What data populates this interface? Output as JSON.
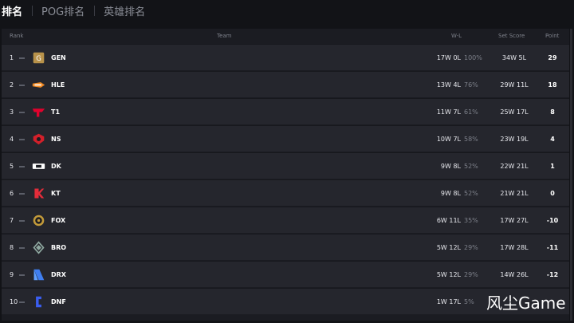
{
  "tabs": [
    {
      "label": "排名"
    },
    {
      "label": "POG排名"
    },
    {
      "label": "英雄排名"
    }
  ],
  "headers": {
    "rank": "Rank",
    "team": "Team",
    "wl": "W-L",
    "score": "Set Score",
    "point": "Point"
  },
  "rows": [
    {
      "rank": "1",
      "team": "GEN",
      "wl": "17W 0L",
      "pct": "100%",
      "score": "34W 5L",
      "point": "29",
      "logo": "gen-logo"
    },
    {
      "rank": "2",
      "team": "HLE",
      "wl": "13W 4L",
      "pct": "76%",
      "score": "29W 11L",
      "point": "18",
      "logo": "hle-logo"
    },
    {
      "rank": "3",
      "team": "T1",
      "wl": "11W 7L",
      "pct": "61%",
      "score": "25W 17L",
      "point": "8",
      "logo": "t1-logo"
    },
    {
      "rank": "4",
      "team": "NS",
      "wl": "10W 7L",
      "pct": "58%",
      "score": "23W 19L",
      "point": "4",
      "logo": "ns-logo"
    },
    {
      "rank": "5",
      "team": "DK",
      "wl": "9W 8L",
      "pct": "52%",
      "score": "22W 21L",
      "point": "1",
      "logo": "dk-logo"
    },
    {
      "rank": "6",
      "team": "KT",
      "wl": "9W 8L",
      "pct": "52%",
      "score": "21W 21L",
      "point": "0",
      "logo": "kt-logo"
    },
    {
      "rank": "7",
      "team": "FOX",
      "wl": "6W 11L",
      "pct": "35%",
      "score": "17W 27L",
      "point": "-10",
      "logo": "fox-logo"
    },
    {
      "rank": "8",
      "team": "BRO",
      "wl": "5W 12L",
      "pct": "29%",
      "score": "17W 28L",
      "point": "-11",
      "logo": "bro-logo"
    },
    {
      "rank": "9",
      "team": "DRX",
      "wl": "5W 12L",
      "pct": "29%",
      "score": "14W 26L",
      "point": "-12",
      "logo": "drx-logo"
    },
    {
      "rank": "10",
      "team": "DNF",
      "wl": "1W 17L",
      "pct": "5%",
      "score": "",
      "point": "",
      "logo": "dnf-logo"
    }
  ],
  "watermark": "风尘Game"
}
